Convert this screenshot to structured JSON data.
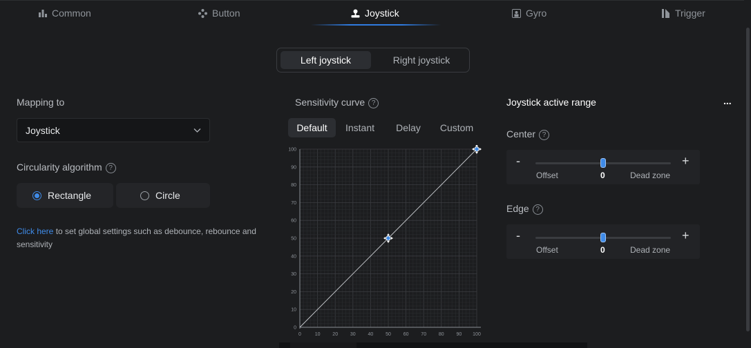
{
  "tabs": [
    {
      "label": "Common",
      "icon": "bar-chart-icon"
    },
    {
      "label": "Button",
      "icon": "dpad-icon"
    },
    {
      "label": "Joystick",
      "icon": "joystick-icon",
      "active": true
    },
    {
      "label": "Gyro",
      "icon": "gyro-icon"
    },
    {
      "label": "Trigger",
      "icon": "trigger-icon"
    }
  ],
  "joystick_switch": {
    "left": "Left joystick",
    "right": "Right joystick",
    "selected": "Left joystick"
  },
  "mapping": {
    "label": "Mapping to",
    "value": "Joystick",
    "algorithm_label": "Circularity algorithm",
    "options": [
      "Rectangle",
      "Circle"
    ],
    "selected": "Rectangle",
    "note_link": "Click here",
    "note_text": " to set global settings such as debounce, rebounce and sensitivity"
  },
  "sensitivity": {
    "label": "Sensitivity curve",
    "tabs": [
      "Default",
      "Instant",
      "Delay",
      "Custom"
    ],
    "selected": "Default"
  },
  "chart_data": {
    "type": "line",
    "x_ticks": [
      0,
      10,
      20,
      30,
      40,
      50,
      60,
      70,
      80,
      90,
      100
    ],
    "y_ticks": [
      0,
      10,
      20,
      30,
      40,
      50,
      60,
      70,
      80,
      90,
      100
    ],
    "xlim": [
      0,
      100
    ],
    "ylim": [
      0,
      100
    ],
    "grid": true,
    "series": [
      {
        "x": [
          0,
          50,
          100
        ],
        "y": [
          0,
          50,
          100
        ]
      }
    ],
    "control_points": [
      {
        "x": 50,
        "y": 50
      },
      {
        "x": 100,
        "y": 100
      }
    ]
  },
  "active_range": {
    "title": "Joystick active range",
    "more": "...",
    "sections": [
      {
        "label": "Center",
        "minus": "-",
        "plus": "+",
        "left_label": "Offset",
        "value": "0",
        "right_label": "Dead zone",
        "level": 0.5
      },
      {
        "label": "Edge",
        "minus": "-",
        "plus": "+",
        "left_label": "Offset",
        "value": "0",
        "right_label": "Dead zone",
        "level": 0.5
      }
    ]
  },
  "colors": {
    "accent": "#3f8be8",
    "background": "#1c1d1f"
  }
}
